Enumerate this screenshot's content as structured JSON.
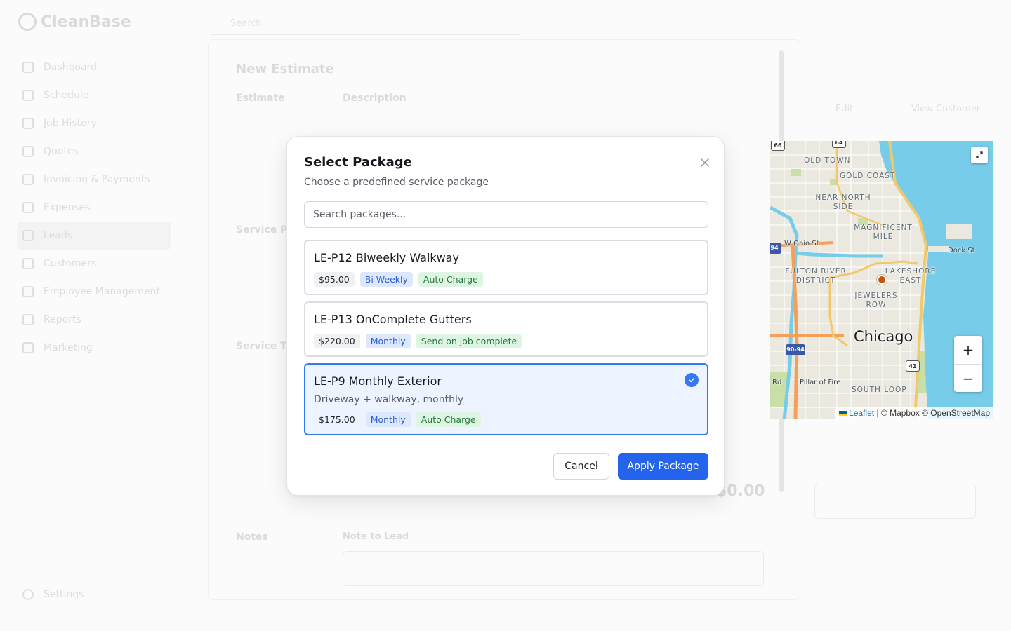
{
  "app": {
    "logo": "CleanBase",
    "search_placeholder": "Search",
    "nav_items": [
      "Dashboard",
      "Schedule",
      "Job History",
      "Quotes",
      "Invoicing & Payments",
      "Expenses",
      "Leads",
      "Customers",
      "Employee Management",
      "Reports",
      "Marketing"
    ],
    "settings": "Settings"
  },
  "background": {
    "page_title": "New Estimate",
    "estimate_label": "Estimate",
    "description_label": "Description",
    "service_package_label": "Service Package",
    "service_total_label": "Service Total",
    "total_value": "$0.00",
    "notes_label": "Notes",
    "note_to_lead_label": "Note to Lead",
    "map_top_edit": "Edit",
    "map_top_view": "View Customer"
  },
  "modal": {
    "title": "Select Package",
    "subtitle": "Choose a predefined service package",
    "search_placeholder": "Search packages...",
    "packages": [
      {
        "name": "LE-P12 Biweekly Walkway",
        "description": "",
        "price": "$95.00",
        "frequency": "Bi-Weekly",
        "billing": "Auto Charge",
        "selected": false
      },
      {
        "name": "LE-P13 OnComplete Gutters",
        "description": "",
        "price": "$220.00",
        "frequency": "Monthly",
        "billing": "Send on job complete",
        "selected": false
      },
      {
        "name": "LE-P9 Monthly Exterior",
        "description": "Driveway + walkway, monthly",
        "price": "$175.00",
        "frequency": "Monthly",
        "billing": "Auto Charge",
        "selected": true
      }
    ],
    "cancel_label": "Cancel",
    "apply_label": "Apply Package",
    "close_icon": "close-icon"
  },
  "map": {
    "city": "Chicago",
    "neighborhoods": [
      "OLD TOWN",
      "GOLD COAST",
      "NEAR NORTH SIDE",
      "MAGNIFICENT MILE",
      "FULTON RIVER DISTRICT",
      "LAKESHORE EAST",
      "JEWELERS ROW",
      "SOUTH LOOP"
    ],
    "streets": [
      "W Ohio St",
      "Dock St",
      "Pillar of Fire",
      "Rd"
    ],
    "highway_shields": [
      "66",
      "64",
      "94",
      "90-94",
      "41"
    ],
    "zoom_in": "+",
    "zoom_out": "−",
    "attribution_leaflet": "Leaflet",
    "attribution_rest": "| © Mapbox © OpenStreetMap",
    "colors": {
      "water": "#77cde9",
      "land": "#ebe8e0",
      "park": "#c9dfa8",
      "highway": "#f4a05a",
      "arterial": "#f2c96a",
      "marker": "#c2570a"
    }
  },
  "colors": {
    "primary": "#2463eb",
    "selected_border": "#3478f6",
    "selected_bg": "#edf4ff"
  }
}
